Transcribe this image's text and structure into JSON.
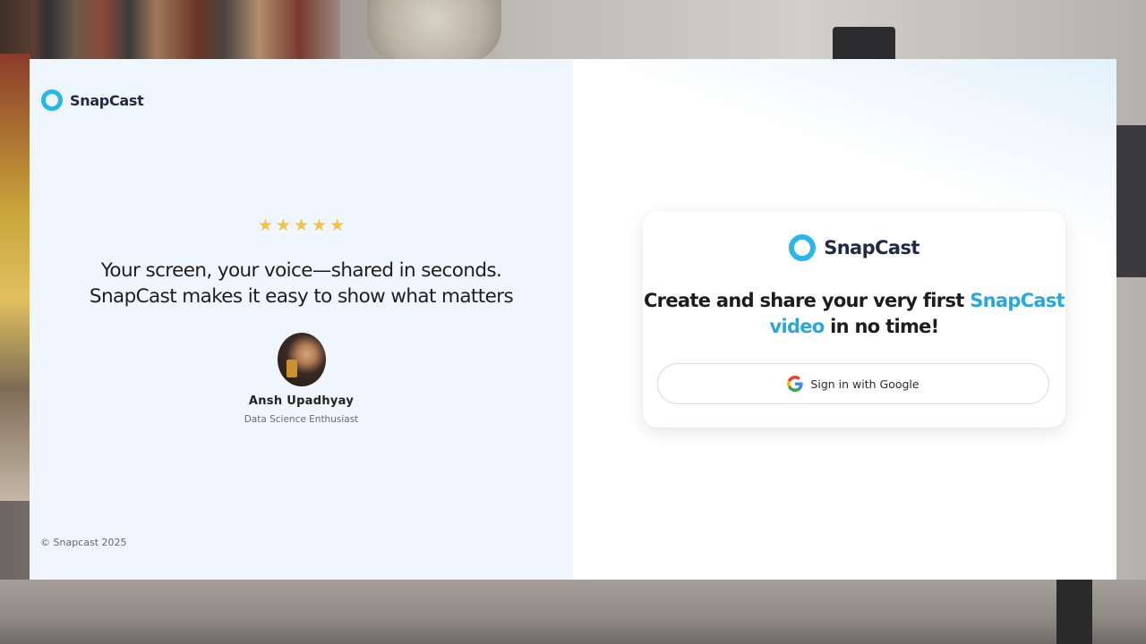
{
  "brand": {
    "name": "SnapCast",
    "accent_color": "#29b6e8"
  },
  "testimonial": {
    "rating": 5,
    "stars": [
      "★",
      "★",
      "★",
      "★",
      "★"
    ],
    "quote_line1": "Your screen, your voice—shared in seconds.",
    "quote_line2": "SnapCast makes it easy to show what matters",
    "person_name": "Ansh Upadhyay",
    "person_role": "Data Science Enthusiast"
  },
  "footer": {
    "copyright": "© Snapcast 2025"
  },
  "signin": {
    "brand_name": "SnapCast",
    "headline_pre": "Create and share your very first ",
    "headline_accent": "SnapCast video",
    "headline_post": " in no time!",
    "google_button_label": "Sign in with Google"
  }
}
